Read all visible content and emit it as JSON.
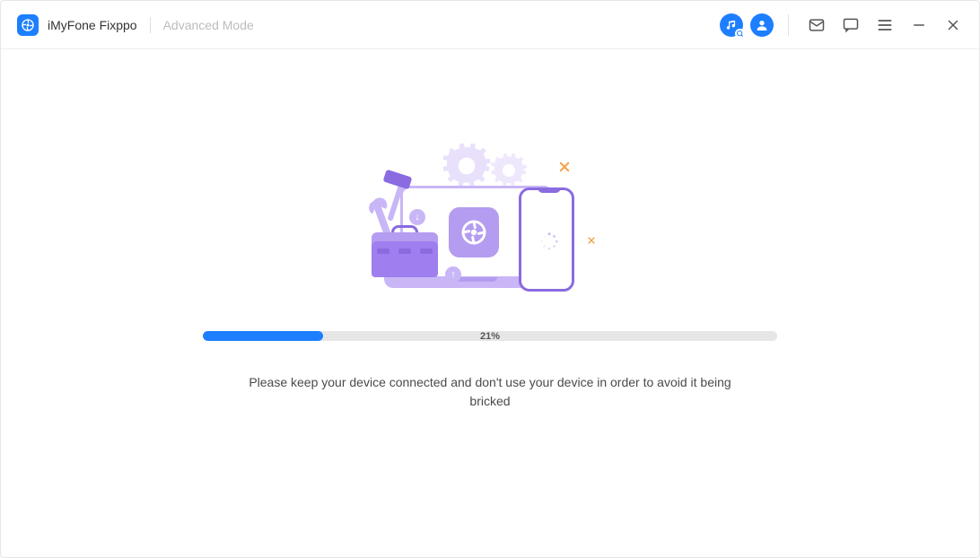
{
  "header": {
    "app_title": "iMyFone Fixppo",
    "mode_label": "Advanced Mode"
  },
  "icons": {
    "logo": "fixppo-logo",
    "music": "music-icon",
    "account": "account-icon",
    "mail": "mail-icon",
    "feedback": "feedback-icon",
    "menu": "menu-icon",
    "minimize": "minimize-icon",
    "close": "close-icon"
  },
  "progress": {
    "percent": 21,
    "label": "21%"
  },
  "instruction_text": "Please keep your device connected and don't use your device in order to avoid it being bricked",
  "colors": {
    "accent": "#1d7fff",
    "illustration_primary": "#b49cf0",
    "illustration_dark": "#8a6be0",
    "sparkle": "#f3a24a"
  }
}
